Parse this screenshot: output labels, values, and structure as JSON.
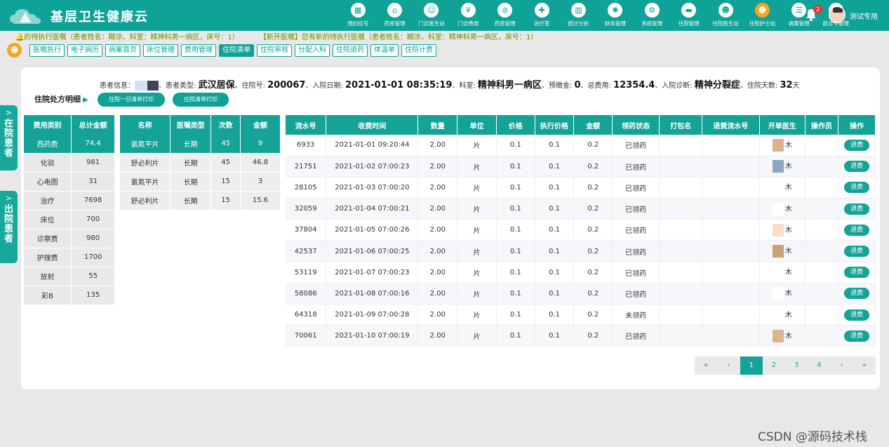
{
  "header": {
    "app_title": "基层卫生健康云",
    "user_name": "测试专用",
    "notification_count": "2",
    "nav": [
      {
        "label": "预约挂号",
        "icon": "calendar-icon",
        "glyph": "▦"
      },
      {
        "label": "药库管理",
        "icon": "home-icon",
        "glyph": "⌂"
      },
      {
        "label": "门诊医生站",
        "icon": "doctor-icon",
        "glyph": "☺"
      },
      {
        "label": "门诊费用",
        "icon": "yen-icon",
        "glyph": "¥"
      },
      {
        "label": "药房管理",
        "icon": "pill-icon",
        "glyph": "⊘"
      },
      {
        "label": "治疗室",
        "icon": "treatment-icon",
        "glyph": "✚"
      },
      {
        "label": "统计分析",
        "icon": "bar-chart-icon",
        "glyph": "▥"
      },
      {
        "label": "财务管理",
        "icon": "finance-icon",
        "glyph": "✺"
      },
      {
        "label": "系统管理",
        "icon": "gear-icon",
        "glyph": "⚙"
      },
      {
        "label": "住院管理",
        "icon": "bed-icon",
        "glyph": "▬"
      },
      {
        "label": "住院医生站",
        "icon": "inpatient-doctor-icon",
        "glyph": "☻"
      },
      {
        "label": "住院护士站",
        "icon": "nurse-icon",
        "glyph": "☻"
      },
      {
        "label": "病案管理",
        "icon": "document-icon",
        "glyph": "☰"
      },
      {
        "label": "就诊卡管理",
        "icon": "card-icon",
        "glyph": "▭"
      }
    ],
    "active_nav": 11
  },
  "notice": {
    "pending": "的待执行医嘱（患者姓名：糊涂，科室：精神科男一病区，床号：1）",
    "new_order": "【新开医嘱】您有新的待执行医嘱（患者姓名：糊涂，科室：精神科男一病区，床号：1）"
  },
  "subtabs": [
    "医嘱执行",
    "电子病历",
    "病案首页",
    "床位管理",
    "费用管理",
    "住院清单",
    "住院审核",
    "分配入科",
    "住院退药",
    "体温单",
    "住院计费"
  ],
  "active_subtab": 5,
  "side": {
    "in_patients": "在院患者",
    "out_patients": "出院患者"
  },
  "patient": {
    "info_label": "患者信息：",
    "type_label": "、患者类型:",
    "type": "武汉居保",
    "no_label": "、住院号:",
    "no": "200067",
    "date_label": "、入院日期:",
    "date": "2021-01-01 08:35:19",
    "dept_label": "、科室:",
    "dept": "精神科男一病区",
    "deposit_label": "、预缴金:",
    "deposit": "0",
    "total_label": "、总费用:",
    "total": "12354.4",
    "diag_label": "、入院诊断:",
    "diag": "精神分裂症",
    "days_label": "、住院天数:",
    "days": "32",
    "days_unit": "天"
  },
  "detail": {
    "title": "住院处方明细",
    "btn_daily": "住院一日清单打印",
    "btn_list": "住院清单打印"
  },
  "fee_table": {
    "headers": [
      "费用类别",
      "总计金额"
    ],
    "rows": [
      [
        "西药费",
        "74.4"
      ],
      [
        "化验",
        "981"
      ],
      [
        "心电图",
        "31"
      ],
      [
        "治疗",
        "7698"
      ],
      [
        "床位",
        "700"
      ],
      [
        "诊察费",
        "980"
      ],
      [
        "护理费",
        "1700"
      ],
      [
        "放射",
        "55"
      ],
      [
        "彩B",
        "135"
      ]
    ],
    "selected": 0
  },
  "drug_table": {
    "headers": [
      "名称",
      "医嘱类型",
      "次数",
      "金额"
    ],
    "rows": [
      [
        "氯氮平片",
        "长期",
        "45",
        "9"
      ],
      [
        "舒必利片",
        "长期",
        "45",
        "46.8"
      ],
      [
        "氯氮平片",
        "长期",
        "15",
        "3"
      ],
      [
        "舒必利片",
        "长期",
        "15",
        "15.6"
      ]
    ],
    "selected": 0
  },
  "detail_table": {
    "headers": [
      "流水号",
      "收费时间",
      "数量",
      "单位",
      "价格",
      "执行价格",
      "金额",
      "领药状态",
      "打包名",
      "退费流水号",
      "开单医生",
      "操作员",
      "操作"
    ],
    "refund_label": "退费",
    "doctor_suffix": "木",
    "rows": [
      {
        "id": "6933",
        "time": "2021-01-01 09:20:44",
        "qty": "2.00",
        "unit": "片",
        "price": "0.1",
        "exec_price": "0.1",
        "amount": "0.2",
        "status": "已领药",
        "mask": "#d7b48f"
      },
      {
        "id": "21751",
        "time": "2021-01-02 07:00:23",
        "qty": "2.00",
        "unit": "片",
        "price": "0.1",
        "exec_price": "0.1",
        "amount": "0.2",
        "status": "已领药",
        "mask": "#8ea6bf"
      },
      {
        "id": "28105",
        "time": "2021-01-03 07:00:20",
        "qty": "2.00",
        "unit": "片",
        "price": "0.1",
        "exec_price": "0.1",
        "amount": "0.2",
        "status": "已领药",
        "mask": "#ffffff"
      },
      {
        "id": "32059",
        "time": "2021-01-04 07:00:21",
        "qty": "2.00",
        "unit": "片",
        "price": "0.1",
        "exec_price": "0.1",
        "amount": "0.2",
        "status": "已领药",
        "mask": "#ffffff"
      },
      {
        "id": "37804",
        "time": "2021-01-05 07:00:26",
        "qty": "2.00",
        "unit": "片",
        "price": "0.1",
        "exec_price": "0.1",
        "amount": "0.2",
        "status": "已领药",
        "mask": "#f5dfc6"
      },
      {
        "id": "42537",
        "time": "2021-01-06 07:00:25",
        "qty": "2.00",
        "unit": "片",
        "price": "0.1",
        "exec_price": "0.1",
        "amount": "0.2",
        "status": "已领药",
        "mask": "#c9a27d"
      },
      {
        "id": "53119",
        "time": "2021-01-07 07:00:23",
        "qty": "2.00",
        "unit": "片",
        "price": "0.1",
        "exec_price": "0.1",
        "amount": "0.2",
        "status": "已领药",
        "mask": "#ffffff"
      },
      {
        "id": "58086",
        "time": "2021-01-08 07:00:16",
        "qty": "2.00",
        "unit": "片",
        "price": "0.1",
        "exec_price": "0.1",
        "amount": "0.2",
        "status": "已领药",
        "mask": "#ffffff"
      },
      {
        "id": "64318",
        "time": "2021-01-09 07:00:28",
        "qty": "2.00",
        "unit": "片",
        "price": "0.1",
        "exec_price": "0.1",
        "amount": "0.2",
        "status": "未领药",
        "mask": "#ffffff"
      },
      {
        "id": "70061",
        "time": "2021-01-10 07:00:19",
        "qty": "2.00",
        "unit": "片",
        "price": "0.1",
        "exec_price": "0.1",
        "amount": "0.2",
        "status": "已领药",
        "mask": "#dbb592"
      }
    ]
  },
  "pager": {
    "items": [
      "«",
      "‹",
      "1",
      "2",
      "3",
      "4",
      "›",
      "»"
    ],
    "active": 2
  },
  "watermark": "CSDN @源码技术栈",
  "colors": {
    "primary": "#0fa297",
    "active_nav": "#f5a623",
    "badge": "#e53935"
  }
}
